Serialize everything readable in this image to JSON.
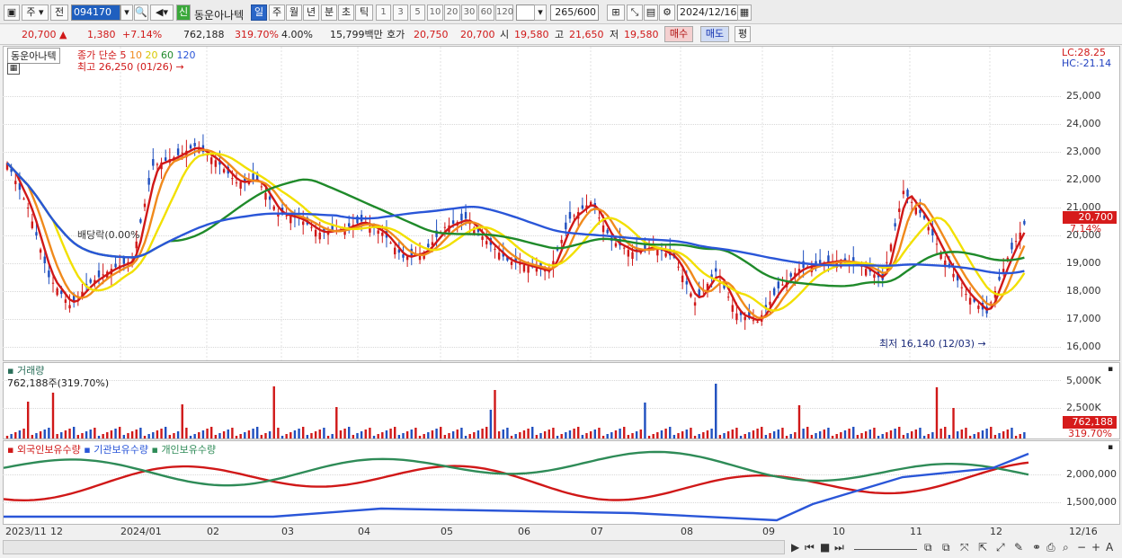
{
  "toolbar": {
    "period_label": "주",
    "prev_label": "전",
    "code": "094170",
    "badge": "신",
    "stock_name": "동운아나텍",
    "periods": [
      "일",
      "주",
      "월",
      "년",
      "분",
      "초",
      "틱"
    ],
    "active_period": "일",
    "ticks": [
      "1",
      "3",
      "5",
      "10",
      "20",
      "30",
      "60",
      "120"
    ],
    "count": "265",
    "count_total": "/600",
    "date": "2024/12/16"
  },
  "quote": {
    "price": "20,700",
    "arrow": "▲",
    "change": "1,380",
    "change_pct": "+7.14%",
    "volume": "762,188",
    "vol_ratio": "319.70%",
    "turnover_pct": "4.00%",
    "amount": "15,799백만",
    "bid_label": "호가",
    "bid": "20,750",
    "ask": "20,700",
    "open_label": "시",
    "open": "19,580",
    "high_label": "고",
    "high": "21,650",
    "low_label": "저",
    "low": "19,580",
    "buy_label": "매수",
    "sell_label": "매도",
    "eval_label": "평"
  },
  "price_panel": {
    "name_tag": "동운아나텍",
    "legend_prefix": "종가 단순",
    "ma_periods": [
      "5",
      "10",
      "20",
      "60",
      "120"
    ],
    "ma_colors": [
      "#d01818",
      "#f08a1c",
      "#f2e000",
      "#1f8a2a",
      "#2a56d8"
    ],
    "high_note": "최고 26,250 (01/26)",
    "low_note": "최저 16,140 (12/03)",
    "dividend_note": "배당락(0.00%",
    "lc": "LC:28.25",
    "hc": "HC:-21.14",
    "y_ticks": [
      "25,000",
      "24,000",
      "23,000",
      "22,000",
      "21,000",
      "20,000",
      "19,000",
      "18,000",
      "17,000",
      "16,000"
    ],
    "current_price": "20,700",
    "current_pct": "7.14%"
  },
  "volume_panel": {
    "title": "거래량",
    "value": "762,188주(319.70%)",
    "y_ticks": [
      "5,000K",
      "2,500K",
      "0"
    ],
    "current": "762,188",
    "current_pct": "319.70%"
  },
  "holders_panel": {
    "legend": [
      "외국인보유수량",
      "기관보유수량",
      "개인보유수량"
    ],
    "colors": [
      "#d01818",
      "#2a56d8",
      "#2e8b57"
    ],
    "y_ticks": [
      "2,000,000",
      "1,500,000"
    ]
  },
  "x_labels": [
    "2023/11",
    "12",
    "2024/01",
    "02",
    "03",
    "04",
    "05",
    "06",
    "07",
    "08",
    "09",
    "10",
    "11",
    "12",
    "12/16"
  ],
  "chart_data": {
    "type": "line",
    "title": "동운아나텍",
    "series": [
      {
        "name": "종가",
        "values": [
          22600,
          21000,
          18500,
          17500,
          18300,
          18800,
          19100,
          22500,
          22800,
          23200,
          22700,
          21900,
          22000,
          20800,
          20600,
          20100,
          20200,
          20500,
          20100,
          19200,
          19400,
          20300,
          20600,
          19800,
          19100,
          18900,
          18700,
          20600,
          21200,
          19800,
          19400,
          19600,
          19200,
          17600,
          18700,
          17200,
          16900,
          18100,
          18800,
          19000,
          19100,
          18900,
          18400,
          21600,
          20600,
          19100,
          17900,
          17200,
          19200,
          20700
        ]
      }
    ],
    "ylim": [
      16000,
      26250
    ],
    "annotations": [
      "최고 26,250 (01/26)",
      "최저 16,140 (12/03)"
    ]
  }
}
